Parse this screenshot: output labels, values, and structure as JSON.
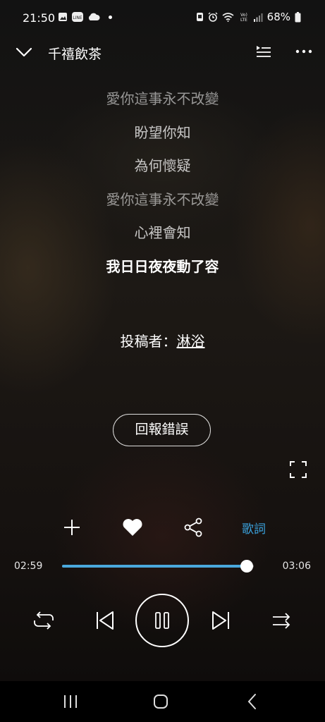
{
  "status_bar": {
    "time": "21:50",
    "battery": "68%",
    "left_icons": [
      "gallery-icon",
      "line-app-icon",
      "cloud-icon",
      "dot-icon"
    ],
    "right_icons": [
      "nfc-icon",
      "alarm-icon",
      "wifi-icon",
      "volte-icon",
      "signal-icon",
      "battery-icon"
    ]
  },
  "header": {
    "title": "千禧飲茶"
  },
  "lyrics": {
    "lines": [
      "愛你這事永不改變",
      "盼望你知",
      "為何懷疑",
      "愛你這事永不改變",
      "心裡會知",
      "我日日夜夜動了容"
    ],
    "contributor_label": "投稿者：",
    "contributor_name": "淋浴"
  },
  "report_button": "回報錯誤",
  "actions": {
    "lyrics_tab": "歌詞"
  },
  "player": {
    "current_time": "02:59",
    "total_time": "03:06",
    "progress_fraction": 0.962,
    "accent_color": "#4aa8dc"
  }
}
